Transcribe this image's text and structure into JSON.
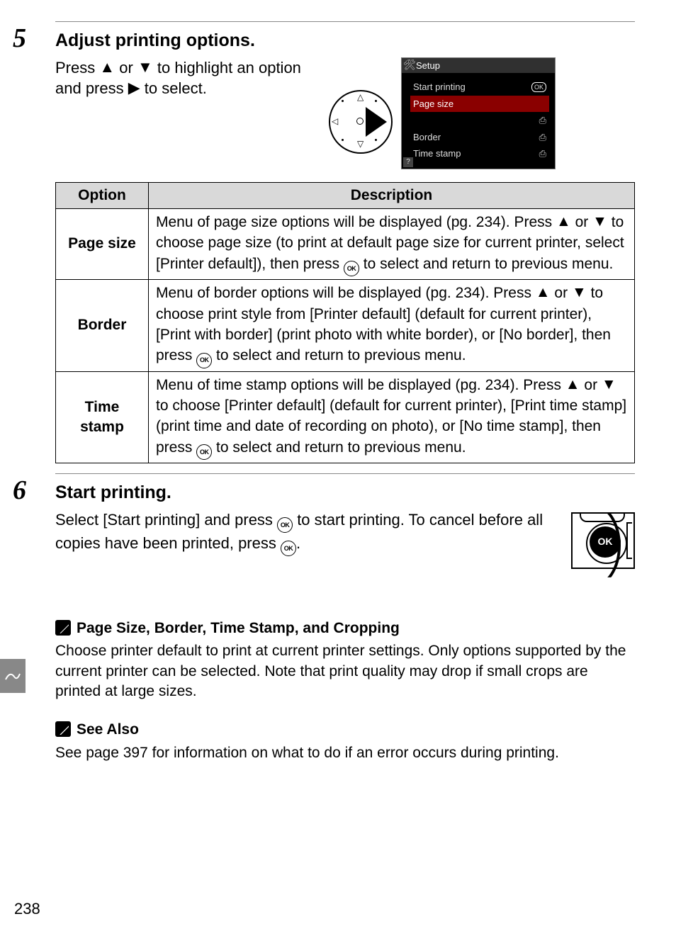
{
  "steps": {
    "s5": {
      "number": "5",
      "title": "Adjust printing options.",
      "body_before": "Press ",
      "body_mid": " or ",
      "body_after_1": " to highlight an option and press ",
      "body_after_2": " to select."
    },
    "s6": {
      "number": "6",
      "title": "Start printing.",
      "body_before": "Select  [Start printing] and press ",
      "body_after_1": " to start printing. To cancel before all copies have been printed, press ",
      "body_after_2": "."
    }
  },
  "glyphs": {
    "up": "▲",
    "down": "▼",
    "right": "▶",
    "ok": "OK"
  },
  "camera_menu": {
    "title": "Setup",
    "items": [
      {
        "label": "Start printing",
        "right": "OK",
        "right_kind": "ok"
      },
      {
        "label": "Page size",
        "right": "",
        "right_kind": "none",
        "selected": true
      },
      {
        "label": "",
        "right": "⎙",
        "right_kind": "printer"
      },
      {
        "label": "Border",
        "right": "⎙",
        "right_kind": "printer"
      },
      {
        "label": "Time stamp",
        "right": "⎙",
        "right_kind": "printer"
      }
    ]
  },
  "table": {
    "headers": {
      "option": "Option",
      "description": "Description"
    },
    "rows": [
      {
        "option": "Page size",
        "desc_parts": [
          "Menu of page size options will be displayed (pg. 234). Press ",
          "UP",
          " or ",
          "DOWN",
          " to choose page size (to print at default page size for current printer, select [Printer default]), then press ",
          "OK",
          " to select and return to previous menu."
        ]
      },
      {
        "option": "Border",
        "desc_parts": [
          "Menu of border options will be displayed (pg. 234).  Press ",
          "UP",
          " or ",
          "DOWN",
          " to choose print style from [Printer default] (default for current printer), [Print with border] (print photo with white border), or [No border], then press ",
          "OK",
          " to select and return to previous menu."
        ]
      },
      {
        "option": "Time stamp",
        "desc_parts": [
          "Menu of time stamp options will be displayed (pg. 234). Press ",
          "UP",
          " or ",
          "DOWN",
          " to choose [Printer default] (default for current printer), [Print time stamp] (print time and date of recording on photo), or [No time stamp], then press ",
          "OK",
          " to select and return to previous menu."
        ]
      }
    ]
  },
  "notes": {
    "n1": {
      "title": "Page Size, Border, Time Stamp, and Cropping",
      "body": "Choose printer default to print at current printer settings.  Only options supported by the current printer can be selected.  Note that print quality may drop if small crops are printed at large sizes."
    },
    "n2": {
      "title": "See Also",
      "body": "See page 397 for information on what to do if an error occurs during printing."
    }
  },
  "pagenum": "238",
  "ok_button_label": "OK"
}
